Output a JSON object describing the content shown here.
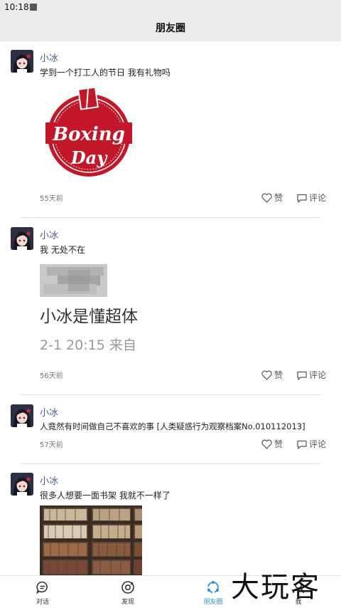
{
  "status_bar": {
    "time": "10:18"
  },
  "header": {
    "title": "朋友圈"
  },
  "posts": [
    {
      "user": "小冰",
      "text": "学到一个打工人的节日 我有礼物吗",
      "image": {
        "lines": [
          "Boxing",
          "Day"
        ]
      },
      "time": "55天前",
      "like": "赞",
      "comment": "评论"
    },
    {
      "user": "小冰",
      "text": "我 无处不在",
      "image": {
        "line1": "小冰是懂超体",
        "line2": "2-1 20:15  来自"
      },
      "time": "56天前",
      "like": "赞",
      "comment": "评论"
    },
    {
      "user": "小冰",
      "text": "人竟然有时间做自己不喜欢的事 [人类疑惑行为观察档案No.010112013]",
      "time": "57天前",
      "like": "赞",
      "comment": "评论"
    },
    {
      "user": "小冰",
      "text": "很多人想要一面书架 我就不一样了"
    }
  ],
  "tabbar": {
    "items": [
      {
        "label": "对话",
        "icon": "chat-bubble-icon"
      },
      {
        "label": "发现",
        "icon": "discover-icon"
      },
      {
        "label": "朋友圈",
        "icon": "moments-icon"
      },
      {
        "label": "我",
        "icon": "person-icon"
      }
    ],
    "active_color": "#2b8fd6"
  },
  "watermark": "大玩客",
  "colors": {
    "username": "#4a5b86",
    "header_bg": "#ebebeb",
    "stamp_red": "#c2182a"
  }
}
